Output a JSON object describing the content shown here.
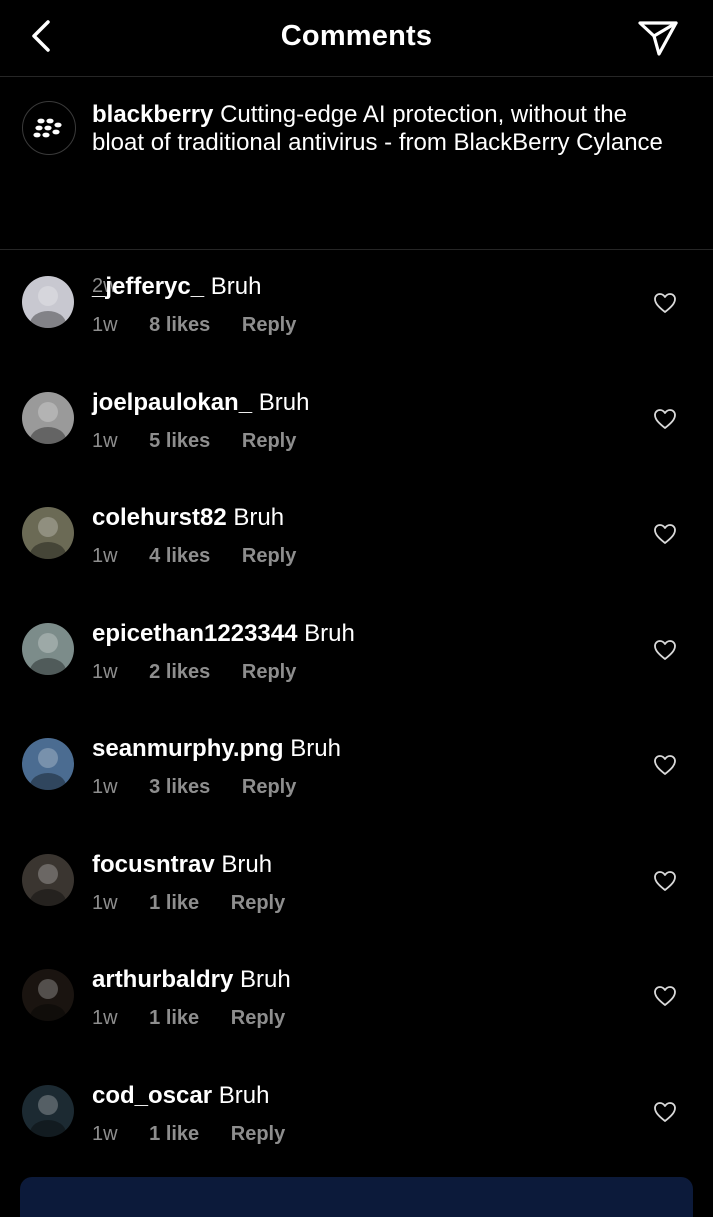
{
  "header": {
    "title": "Comments"
  },
  "caption": {
    "username": "blackberry",
    "text": " Cutting-edge AI protection, without the bloat of traditional antivirus - from BlackBerry Cylance",
    "time": "2w"
  },
  "comments": [
    {
      "username": "_jefferyc_",
      "text": " Bruh",
      "time": "1w",
      "likes": "8 likes",
      "reply": "Reply",
      "avatar_color": "#c8c8d0"
    },
    {
      "username": "joelpaulokan_",
      "text": " Bruh",
      "time": "1w",
      "likes": "5 likes",
      "reply": "Reply",
      "avatar_color": "#9a9a9a"
    },
    {
      "username": "colehurst82",
      "text": " Bruh",
      "time": "1w",
      "likes": "4 likes",
      "reply": "Reply",
      "avatar_color": "#6b6a55"
    },
    {
      "username": "epicethan1223344",
      "text": " Bruh",
      "time": "1w",
      "likes": "2 likes",
      "reply": "Reply",
      "avatar_color": "#7c8c8a"
    },
    {
      "username": "seanmurphy.png",
      "text": " Bruh",
      "time": "1w",
      "likes": "3 likes",
      "reply": "Reply",
      "avatar_color": "#4b6c91"
    },
    {
      "username": "focusntrav",
      "text": " Bruh",
      "time": "1w",
      "likes": "1 like",
      "reply": "Reply",
      "avatar_color": "#3a3530"
    },
    {
      "username": "arthurbaldry",
      "text": " Bruh",
      "time": "1w",
      "likes": "1 like",
      "reply": "Reply",
      "avatar_color": "#1a1410"
    },
    {
      "username": "cod_oscar",
      "text": " Bruh",
      "time": "1w",
      "likes": "1 like",
      "reply": "Reply",
      "avatar_color": "#1c2a32"
    }
  ],
  "colors": {
    "background": "#000000",
    "muted_text": "#8e8e8e",
    "divider": "#262626"
  }
}
